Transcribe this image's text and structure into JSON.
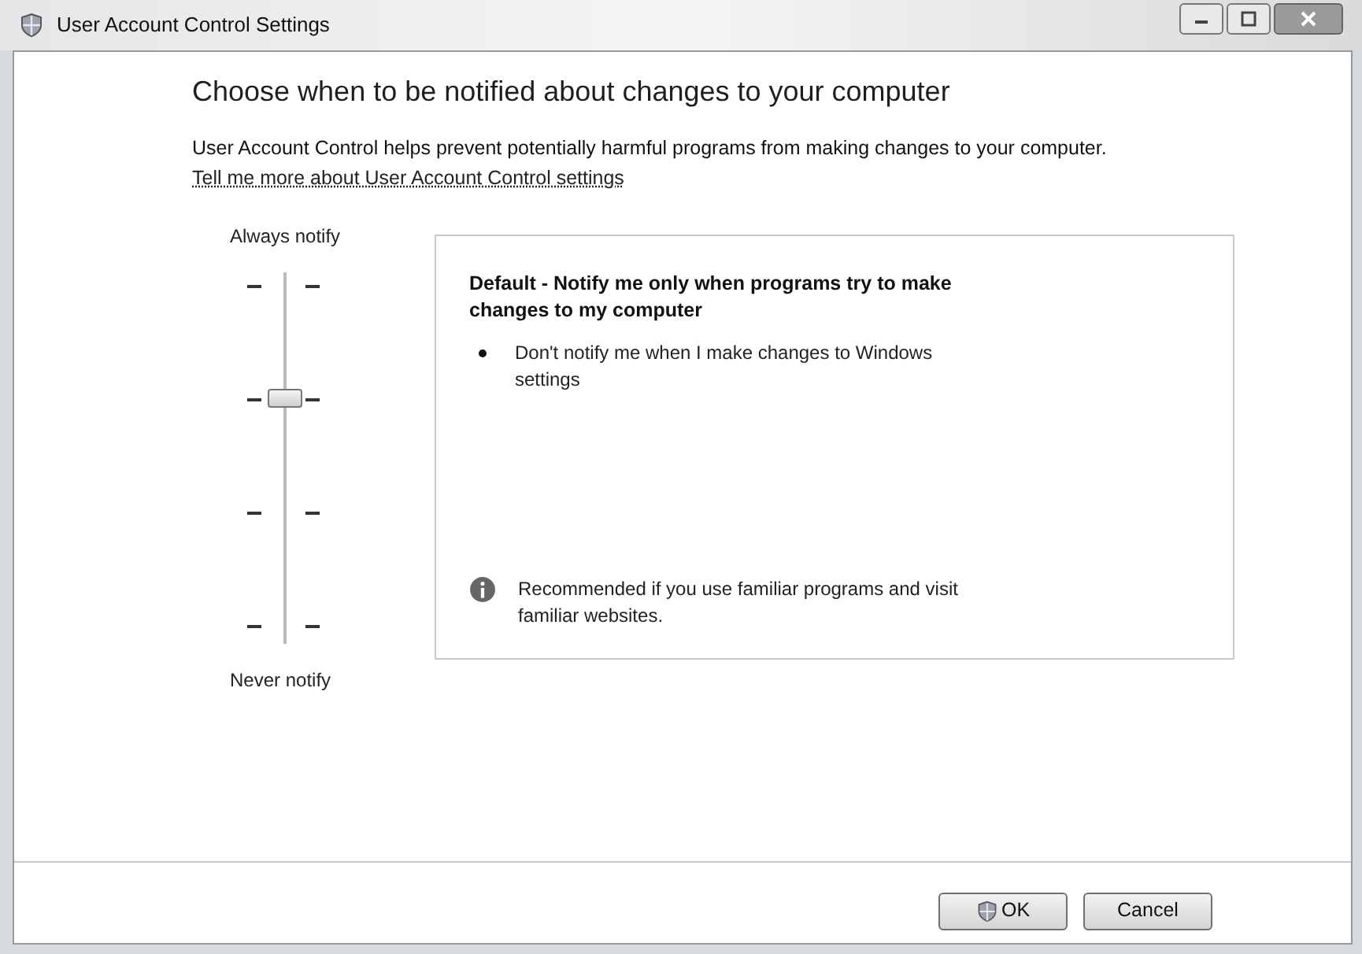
{
  "window": {
    "title": "User Account Control Settings"
  },
  "heading": "Choose when to be notified about changes to your computer",
  "description": "User Account Control helps prevent potentially harmful programs from making changes to your computer.",
  "link": "Tell me more about User Account Control settings",
  "slider": {
    "top_label": "Always notify",
    "bottom_label": "Never notify",
    "level": 0.67
  },
  "panel": {
    "title": "Default - Notify me only when programs try to make changes to my computer",
    "bullets": [
      "Don't notify me when I make changes to Windows settings"
    ],
    "note": "Recommended if you use familiar programs and visit familiar websites."
  },
  "buttons": [
    {
      "label": "OK",
      "shield": true
    },
    {
      "label": "Cancel",
      "shield": false
    }
  ]
}
